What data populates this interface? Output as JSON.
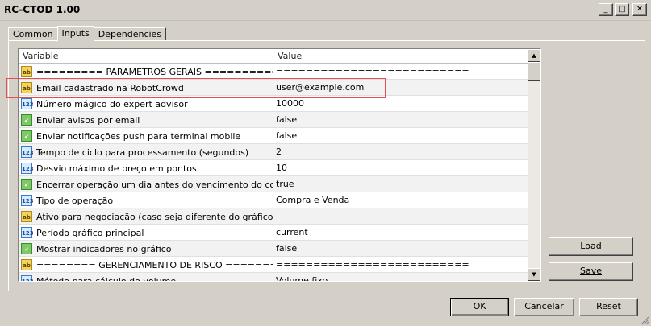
{
  "window": {
    "title": "RC-CTOD 1.00",
    "minimize": "_",
    "maximize": "□",
    "close": "✕"
  },
  "tabs": [
    "Common",
    "Inputs",
    "Dependencies"
  ],
  "grid": {
    "headers": {
      "variable": "Variable",
      "value": "Value"
    },
    "rows": [
      {
        "type": "str",
        "variable": "========= PARAMETROS GERAIS ==========",
        "value": "=========================="
      },
      {
        "type": "str",
        "variable": "Email cadastrado na RobotCrowd",
        "value": "user@example.com"
      },
      {
        "type": "num",
        "variable": "Número mágico do expert advisor",
        "value": "10000"
      },
      {
        "type": "bool",
        "variable": "Enviar avisos por email",
        "value": "false"
      },
      {
        "type": "bool",
        "variable": "Enviar notificações push para terminal mobile",
        "value": "false"
      },
      {
        "type": "num",
        "variable": "Tempo de ciclo para processamento (segundos)",
        "value": "2"
      },
      {
        "type": "num",
        "variable": "Desvio máximo de preço em pontos",
        "value": "10"
      },
      {
        "type": "bool",
        "variable": "Encerrar operação um dia antes do vencimento do contrato",
        "value": "true"
      },
      {
        "type": "enum",
        "variable": "Tipo de operação",
        "value": "Compra e Venda"
      },
      {
        "type": "str",
        "variable": "Ativo para negociação (caso seja diferente do gráfico)",
        "value": ""
      },
      {
        "type": "enum",
        "variable": "Período gráfico principal",
        "value": "current"
      },
      {
        "type": "bool",
        "variable": "Mostrar indicadores no gráfico",
        "value": "false"
      },
      {
        "type": "str",
        "variable": "======== GERENCIAMENTO DE RISCO =======",
        "value": "=========================="
      },
      {
        "type": "enum",
        "variable": "Método para cálculo do volume",
        "value": "Volume fixo"
      }
    ],
    "icons": {
      "str": "ab",
      "num": "123",
      "bool": "✔",
      "enum": "123"
    },
    "highlighted_row": 1
  },
  "side_buttons": {
    "load": "Load",
    "save": "Save"
  },
  "footer_buttons": {
    "ok": "OK",
    "cancel": "Cancelar",
    "reset": "Reset"
  },
  "scrollbar": {
    "up": "▲",
    "down": "▼"
  },
  "colors": {
    "highlight": "#e05050"
  }
}
